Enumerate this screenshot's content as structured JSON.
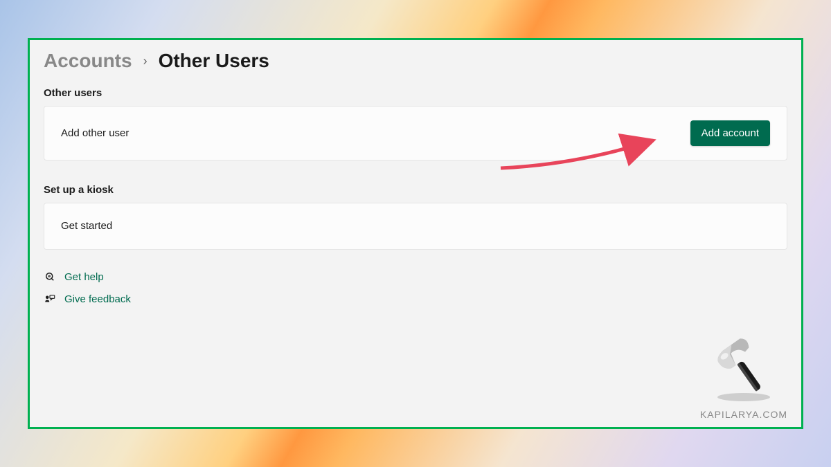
{
  "breadcrumb": {
    "parent": "Accounts",
    "current": "Other Users"
  },
  "sections": {
    "other_users": {
      "header": "Other users",
      "item_label": "Add other user",
      "button_label": "Add account"
    },
    "kiosk": {
      "header": "Set up a kiosk",
      "item_label": "Get started"
    }
  },
  "help": {
    "get_help": "Get help",
    "give_feedback": "Give feedback"
  },
  "watermark": "KAPILARYA.COM",
  "colors": {
    "accent": "#006b4f",
    "border_highlight": "#00b050"
  }
}
